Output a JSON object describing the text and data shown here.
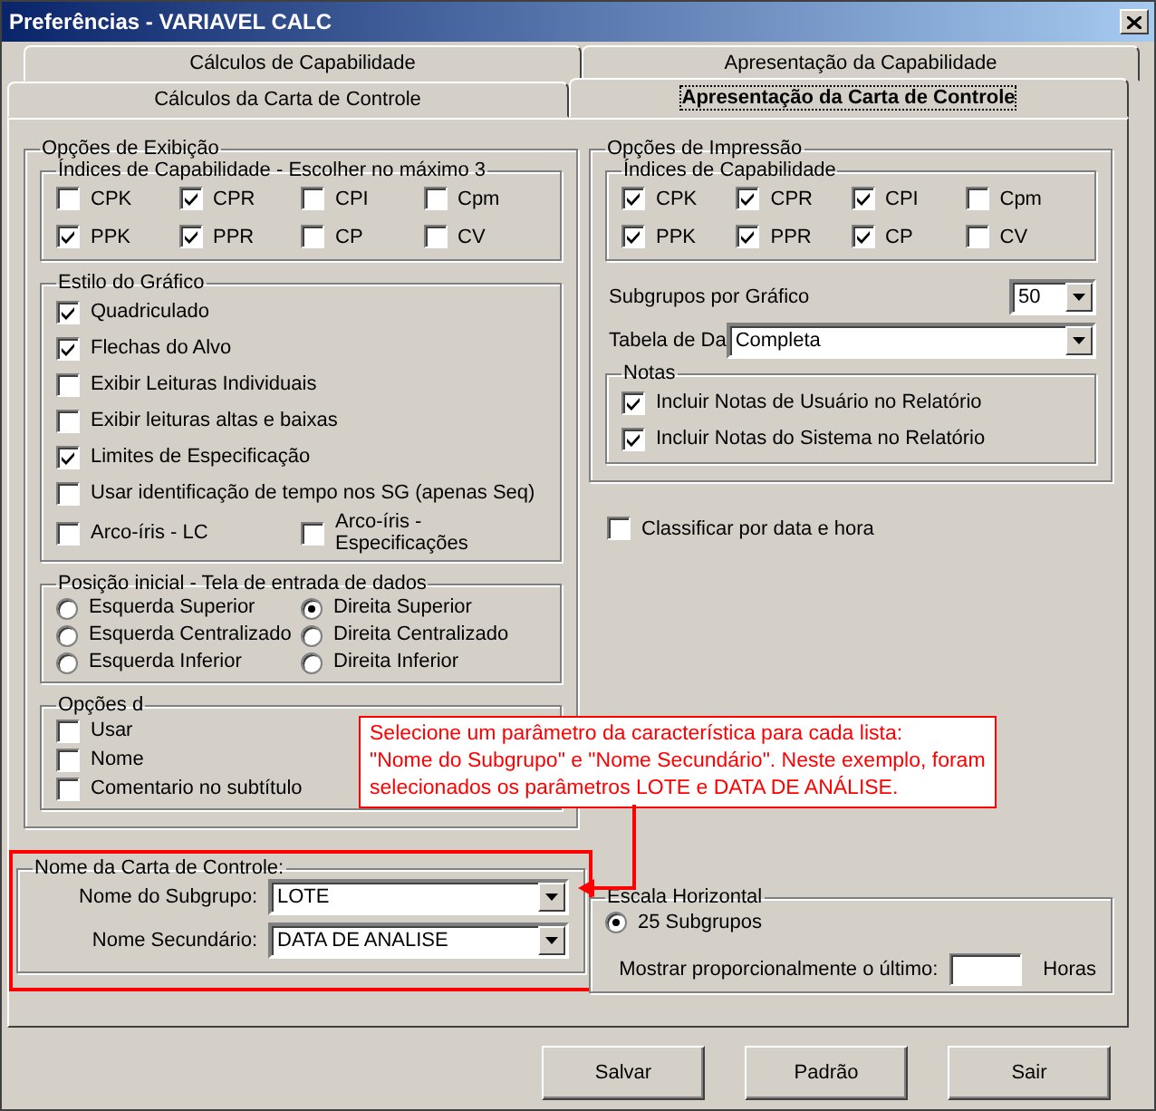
{
  "window": {
    "title": "Preferências - VARIAVEL CALC"
  },
  "tab_rows": [
    [
      {
        "label": "Cálculos de Capabilidade",
        "selected": false
      },
      {
        "label": "Apresentação da Capabilidade",
        "selected": false
      }
    ],
    [
      {
        "label": "Cálculos da Carta de Controle",
        "selected": false
      },
      {
        "label": "Apresentação da Carta de Controle",
        "selected": true
      }
    ]
  ],
  "display_options": {
    "title": "Opções de Exibição",
    "capability_indices": {
      "title": "Índices de Capabilidade - Escolher no máximo 3",
      "items": [
        {
          "label": "CPK",
          "checked": false
        },
        {
          "label": "CPR",
          "checked": true
        },
        {
          "label": "CPI",
          "checked": false
        },
        {
          "label": "Cpm",
          "checked": false
        },
        {
          "label": "PPK",
          "checked": true
        },
        {
          "label": "PPR",
          "checked": true
        },
        {
          "label": "CP",
          "checked": false
        },
        {
          "label": "CV",
          "checked": false
        }
      ]
    },
    "chart_style": {
      "title": "Estilo do Gráfico",
      "items": [
        {
          "label": "Quadriculado",
          "checked": true
        },
        {
          "label": "Flechas do Alvo",
          "checked": true
        },
        {
          "label": "Exibir Leituras Individuais",
          "checked": false
        },
        {
          "label": "Exibir leituras altas e baixas",
          "checked": false
        },
        {
          "label": "Limites de Especificação",
          "checked": true
        },
        {
          "label": "Usar identificação de tempo nos SG (apenas Seq)",
          "checked": false
        }
      ],
      "split_items": [
        {
          "label": "Arco-íris - LC",
          "checked": false
        },
        {
          "label": "Arco-íris - Especificações",
          "checked": false
        }
      ]
    },
    "start_position": {
      "title": "Posição inicial - Tela de entrada de dados",
      "options": [
        {
          "label": "Esquerda Superior",
          "selected": false
        },
        {
          "label": "Direita Superior",
          "selected": true
        },
        {
          "label": "Esquerda Centralizado",
          "selected": false
        },
        {
          "label": "Direita Centralizado",
          "selected": false
        },
        {
          "label": "Esquerda Inferior",
          "selected": false
        },
        {
          "label": "Direita Inferior",
          "selected": false
        }
      ]
    },
    "data_entry": {
      "title": "Opções d",
      "items": [
        {
          "label": "Usar",
          "checked": false
        },
        {
          "label": "Nome",
          "checked": false
        },
        {
          "label": "Comentario no subtítulo",
          "checked": false
        }
      ]
    }
  },
  "chart_name": {
    "title": "Nome da Carta de Controle:",
    "fields": [
      {
        "label": "Nome do Subgrupo:",
        "value": "LOTE"
      },
      {
        "label": "Nome Secundário:",
        "value": "DATA DE ANALISE"
      }
    ]
  },
  "print_options": {
    "title": "Opções de Impressão",
    "capability_indices": {
      "title": "Índices de Capabilidade",
      "items": [
        {
          "label": "CPK",
          "checked": true
        },
        {
          "label": "CPR",
          "checked": true
        },
        {
          "label": "CPI",
          "checked": true
        },
        {
          "label": "Cpm",
          "checked": false
        },
        {
          "label": "PPK",
          "checked": true
        },
        {
          "label": "PPR",
          "checked": true
        },
        {
          "label": "CP",
          "checked": true
        },
        {
          "label": "CV",
          "checked": false
        }
      ]
    },
    "subgroups_per_chart": {
      "label": "Subgrupos por Gráfico",
      "value": "50"
    },
    "data_table": {
      "label": "Tabela de Da",
      "value": "Completa"
    },
    "notes": {
      "title": "Notas",
      "items": [
        {
          "label": "Incluir Notas de Usuário no Relatório",
          "checked": true
        },
        {
          "label": "Incluir Notas do Sistema no Relatório",
          "checked": true
        }
      ]
    }
  },
  "sort_by_date": {
    "label": "Classificar por data e hora",
    "checked": false
  },
  "horizontal_scale": {
    "title": "Escala Horizontal",
    "option": {
      "label": "25 Subgrupos",
      "selected": true
    },
    "show_last": {
      "label": "Mostrar proporcionalmente o último:",
      "unit": "Horas"
    }
  },
  "callout": {
    "text": "Selecione um parâmetro da característica para cada lista:\n\"Nome do Subgrupo\" e \"Nome Secundário\". Neste exemplo, foram\nselecionados os parâmetros LOTE e DATA DE ANÁLISE."
  },
  "buttons": [
    "Salvar",
    "Padrão",
    "Sair"
  ]
}
